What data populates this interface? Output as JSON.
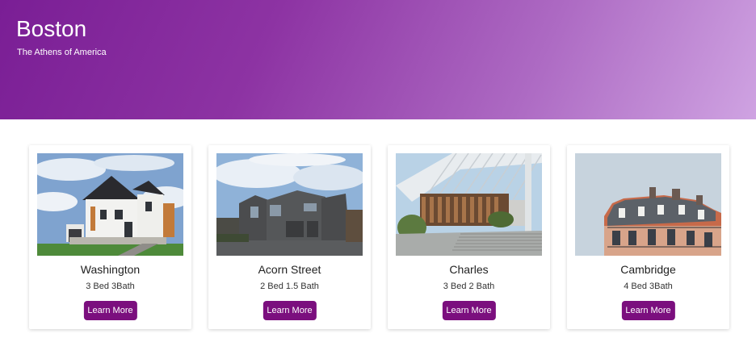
{
  "hero": {
    "title": "Boston",
    "subtitle": "The Athens of America"
  },
  "cards": [
    {
      "title": "Washington",
      "description": "3 Bed 3Bath",
      "button_label": "Learn More",
      "image": "house-photo"
    },
    {
      "title": "Acorn Street",
      "description": "2 Bed 1.5 Bath",
      "button_label": "Learn More",
      "image": "house-photo"
    },
    {
      "title": "Charles",
      "description": "3 Bed 2 Bath",
      "button_label": "Learn More",
      "image": "modern-building-photo"
    },
    {
      "title": "Cambridge",
      "description": "4 Bed 3Bath",
      "button_label": "Learn More",
      "image": "apartment-building-photo"
    }
  ],
  "colors": {
    "hero_gradient_start": "#7a1e95",
    "hero_gradient_end": "#cfa3e2",
    "button": "#7b0f7e"
  }
}
